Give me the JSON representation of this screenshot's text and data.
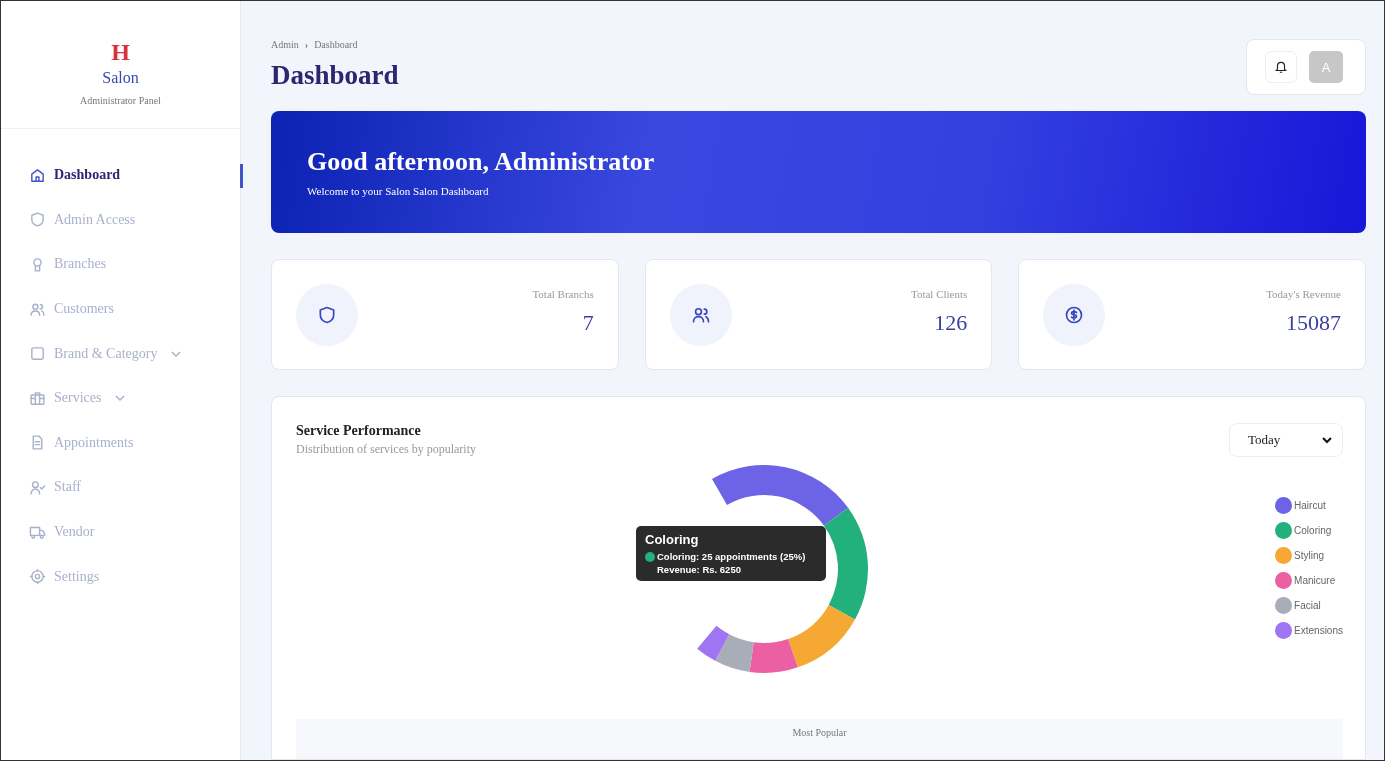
{
  "sidebar": {
    "logo": {
      "letter": "H",
      "name": "Salon",
      "subtitle": "Administrator Panel"
    },
    "items": [
      {
        "label": "Dashboard",
        "selected": true,
        "expandable": false
      },
      {
        "label": "Admin Access",
        "selected": false,
        "expandable": false
      },
      {
        "label": "Branches",
        "selected": false,
        "expandable": false
      },
      {
        "label": "Customers",
        "selected": false,
        "expandable": false
      },
      {
        "label": "Brand & Category",
        "selected": false,
        "expandable": true
      },
      {
        "label": "Services",
        "selected": false,
        "expandable": true
      },
      {
        "label": "Appointments",
        "selected": false,
        "expandable": false
      },
      {
        "label": "Staff",
        "selected": false,
        "expandable": false
      },
      {
        "label": "Vendor",
        "selected": false,
        "expandable": false
      },
      {
        "label": "Settings",
        "selected": false,
        "expandable": false
      }
    ]
  },
  "header": {
    "breadcrumb": [
      "Admin",
      "Dashboard"
    ],
    "breadcrumb_separator": "›",
    "title": "Dashboard",
    "avatar": "A"
  },
  "banner": {
    "title": "Good afternoon, Administrator",
    "subtitle": "Welcome to your Salon Salon Dashboard"
  },
  "stats": [
    {
      "label": "Total Branchs",
      "value": "7"
    },
    {
      "label": "Total Clients",
      "value": "126"
    },
    {
      "label": "Today's Revenue",
      "value": "15087"
    }
  ],
  "performance": {
    "title": "Service Performance",
    "subtitle": "Distribution of services by popularity",
    "period": "Today",
    "legend": [
      {
        "label": "Haircut",
        "color": "#6c63e6"
      },
      {
        "label": "Coloring",
        "color": "#22b07d"
      },
      {
        "label": "Styling",
        "color": "#f5a833"
      },
      {
        "label": "Manicure",
        "color": "#ec5fa3"
      },
      {
        "label": "Facial",
        "color": "#a9adb8"
      },
      {
        "label": "Extensions",
        "color": "#9f75f4"
      }
    ],
    "tooltip": {
      "title": "Coloring",
      "line": "Coloring: 25 appointments (25%)",
      "detail": "Revenue: Rs. 6250"
    },
    "footer_label": "Most Popular"
  }
}
